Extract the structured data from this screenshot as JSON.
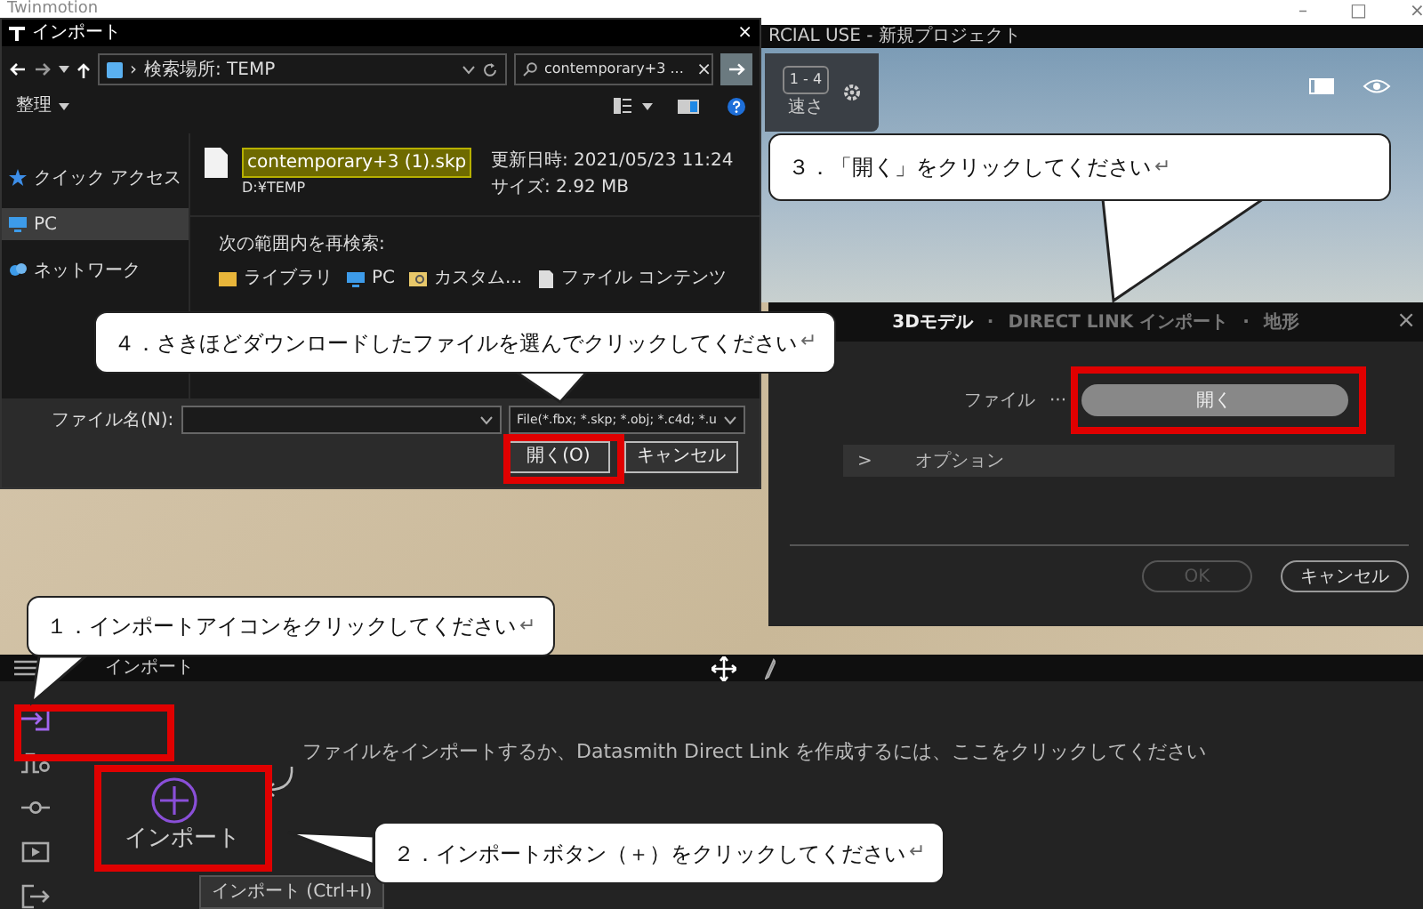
{
  "app_window": {
    "app_name": "Twinmotion",
    "title": "RCIAL USE - 新規プロジェクト",
    "window_controls": [
      "–",
      "□",
      "×"
    ]
  },
  "viewport_toolbar": {
    "speed_value": "1 - 4",
    "speed_label": "速さ"
  },
  "file_dialog": {
    "title": "インポート",
    "close": "×",
    "address": "検索場所: TEMP",
    "address_separator": "›",
    "search_value": "contemporary+3 ...",
    "search_clear": "×",
    "organize": "整理",
    "nav_items": [
      {
        "label": "クイック アクセス",
        "kind": "star",
        "selected": false
      },
      {
        "label": "PC",
        "kind": "pc",
        "selected": true
      },
      {
        "label": "ネットワーク",
        "kind": "network",
        "selected": false
      }
    ],
    "result": {
      "name": "contemporary+3 (1).skp",
      "highlighted": true,
      "folder": "D:¥TEMP",
      "modified": "更新日時: 2021/05/23 11:24",
      "size": "サイズ: 2.92 MB"
    },
    "search_again_label": "次の範囲内を再検索:",
    "search_again_links": [
      {
        "label": "ライブラリ",
        "kind": "library"
      },
      {
        "label": "PC",
        "kind": "pc"
      },
      {
        "label": "カスタム...",
        "kind": "custom"
      },
      {
        "label": "ファイル コンテンツ",
        "kind": "document"
      }
    ],
    "file_name_label": "ファイル名(N):",
    "file_type": "File(*.fbx; *.skp; *.obj; *.c4d; *.u",
    "open_button": "開く(O)",
    "cancel_button": "キャンセル"
  },
  "import_dialog": {
    "tabs": [
      {
        "label": "3Dモデル",
        "selected": true
      },
      {
        "label": "DIRECT LINK インポート",
        "selected": false
      },
      {
        "label": "地形",
        "selected": false
      }
    ],
    "separator": "·",
    "close": "×",
    "file_label": "ファイル",
    "browse": "···",
    "open_button": "開く",
    "options_label": "オプション",
    "options_expanded": false,
    "options_toggle": ">",
    "ok_button": {
      "label": "OK",
      "disabled": true
    },
    "cancel_button": "キャンセル"
  },
  "bottom_panel": {
    "panel_title": "インポート",
    "sidebar_items": [
      {
        "kind": "import",
        "selected": true
      },
      {
        "kind": "path",
        "selected": false
      },
      {
        "kind": "slider",
        "selected": false
      },
      {
        "kind": "media",
        "selected": false
      },
      {
        "kind": "export",
        "selected": false
      }
    ],
    "hint": "ファイルをインポートするか、Datasmith Direct Link を作成するには、ここをクリックしてください",
    "import_button": "インポート",
    "tooltip": "インポート (Ctrl+I)"
  },
  "callouts": [
    {
      "text": "１．インポートアイコンをクリックしてください",
      "mark": "↵"
    },
    {
      "text": "２．インポートボタン（＋）をクリックしてください",
      "mark": "↵"
    },
    {
      "text": "３．「開く」をクリックしてください",
      "mark": "↵"
    },
    {
      "text": "４．さきほどダウンロードしたファイルを選んでクリックしてください",
      "mark": "↵"
    }
  ]
}
